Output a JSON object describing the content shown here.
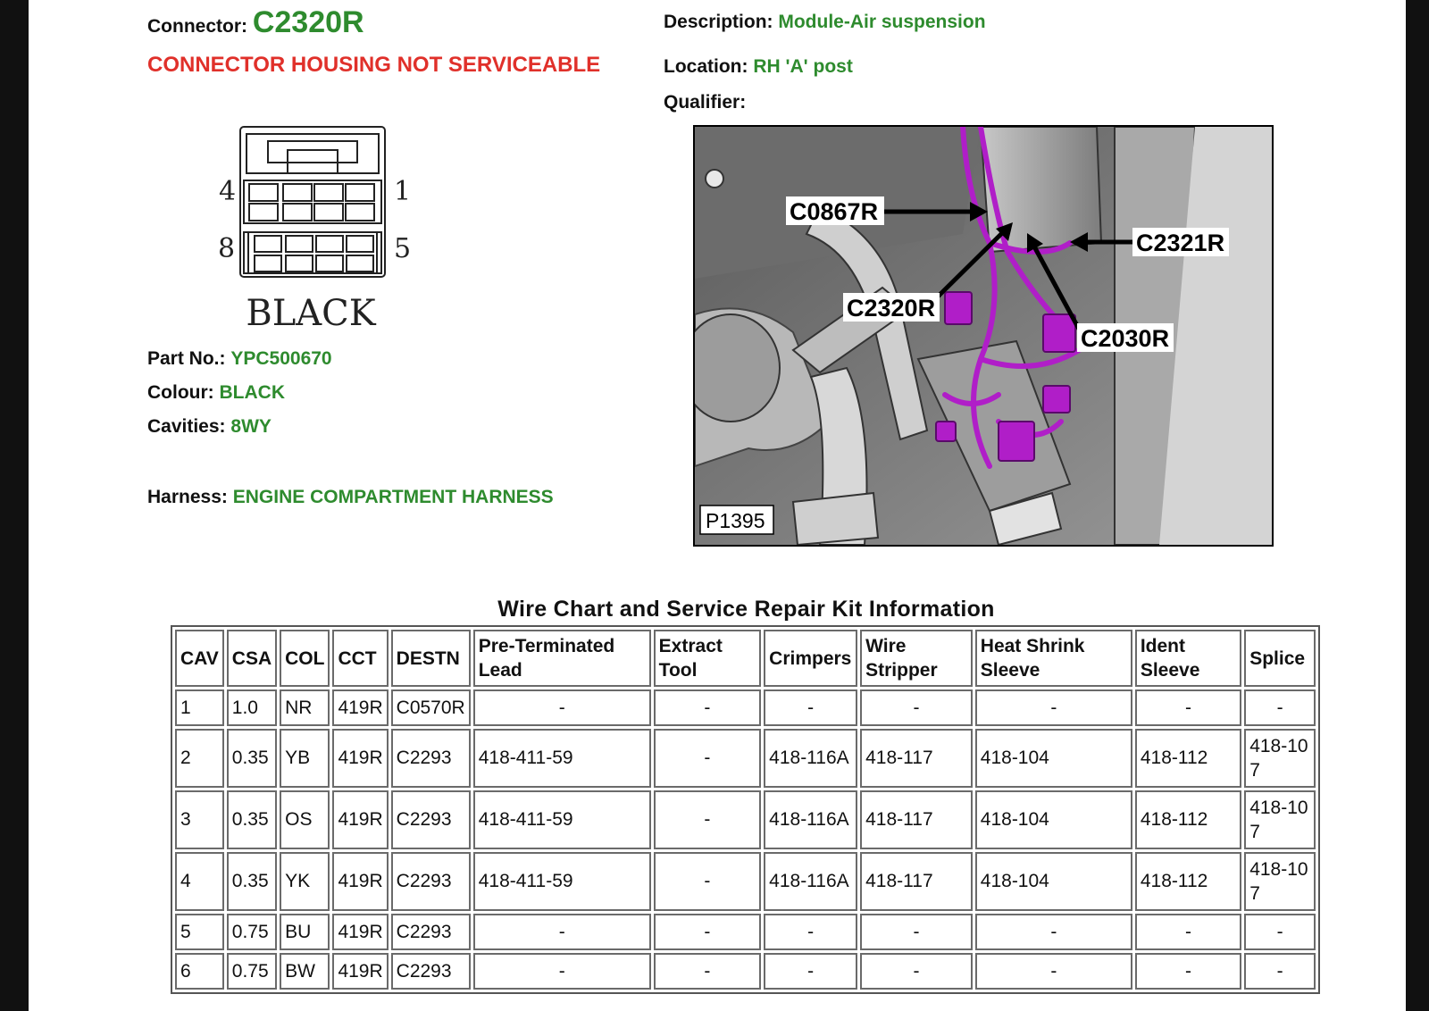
{
  "header": {
    "connector_label": "Connector:",
    "connector_value": "C2320R",
    "warning": "CONNECTOR HOUSING NOT SERVICEABLE",
    "description_label": "Description:",
    "description_value": "Module-Air suspension",
    "location_label": "Location:",
    "location_value": "RH 'A' post",
    "qualifier_label": "Qualifier:"
  },
  "pinout": {
    "pin_4": "4",
    "pin_1": "1",
    "pin_8": "8",
    "pin_5": "5",
    "colour_caption": "BLACK"
  },
  "details": {
    "part_label": "Part No.:",
    "part_value": "YPC500670",
    "colour_label": "Colour:",
    "colour_value": "BLACK",
    "cavities_label": "Cavities:",
    "cavities_value": "8WY",
    "harness_label": "Harness:",
    "harness_value": "ENGINE COMPARTMENT HARNESS"
  },
  "photo": {
    "callouts": [
      "C0867R",
      "C2321R",
      "C2320R",
      "C2030R"
    ],
    "figure_id": "P1395"
  },
  "wire_chart": {
    "title": "Wire Chart and Service Repair Kit Information",
    "headers": [
      "CAV",
      "CSA",
      "COL",
      "CCT",
      "DESTN",
      "Pre-Terminated Lead",
      "Extract Tool",
      "Crimpers",
      "Wire Stripper",
      "Heat Shrink Sleeve",
      "Ident Sleeve",
      "Splice"
    ],
    "rows": [
      [
        "1",
        "1.0",
        "NR",
        "419R",
        "C0570R",
        "-",
        "-",
        "-",
        "-",
        "-",
        "-",
        "-"
      ],
      [
        "2",
        "0.35",
        "YB",
        "419R",
        "C2293",
        "418-411-59",
        "-",
        "418-116A",
        "418-117",
        "418-104",
        "418-112",
        "418-107"
      ],
      [
        "3",
        "0.35",
        "OS",
        "419R",
        "C2293",
        "418-411-59",
        "-",
        "418-116A",
        "418-117",
        "418-104",
        "418-112",
        "418-107"
      ],
      [
        "4",
        "0.35",
        "YK",
        "419R",
        "C2293",
        "418-411-59",
        "-",
        "418-116A",
        "418-117",
        "418-104",
        "418-112",
        "418-107"
      ],
      [
        "5",
        "0.75",
        "BU",
        "419R",
        "C2293",
        "-",
        "-",
        "-",
        "-",
        "-",
        "-",
        "-"
      ],
      [
        "6",
        "0.75",
        "BW",
        "419R",
        "C2293",
        "-",
        "-",
        "-",
        "-",
        "-",
        "-",
        "-"
      ]
    ]
  },
  "colors": {
    "value_green": "#2e8b2e",
    "warning_red": "#e0302a",
    "wire_purple": "#b01ec8"
  }
}
